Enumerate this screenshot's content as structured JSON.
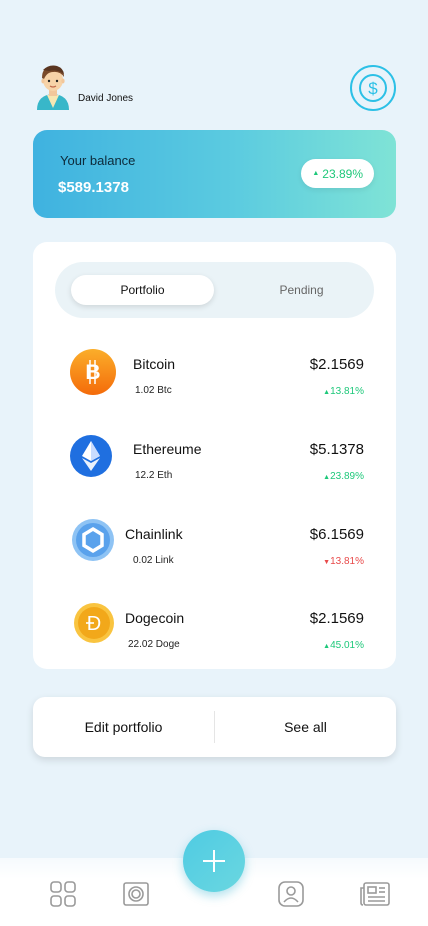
{
  "user": {
    "name": "David Jones",
    "avatar_icon": "boy-avatar-icon"
  },
  "header": {
    "coin_icon": "dollar-coin-icon",
    "accent": "#2cc0e6"
  },
  "balance": {
    "label": "Your balance",
    "value": "$589.1378",
    "change": "23.89%",
    "change_direction": "up"
  },
  "tabs": [
    {
      "label": "Portfolio",
      "active": true
    },
    {
      "label": "Pending",
      "active": false
    }
  ],
  "assets": [
    {
      "name": "Bitcoin",
      "amount": "1.02 Btc",
      "price": "$2.1569",
      "change": "13.81%",
      "direction": "up",
      "icon": "bitcoin-icon",
      "color": "#f7931a"
    },
    {
      "name": "Ethereume",
      "amount": "12.2 Eth",
      "price": "$5.1378",
      "change": "23.89%",
      "direction": "up",
      "icon": "ethereum-icon",
      "color": "#1f6fe0"
    },
    {
      "name": "Chainlink",
      "amount": "0.02 Link",
      "price": "$6.1569",
      "change": "13.81%",
      "direction": "down",
      "icon": "chainlink-icon",
      "color": "#7fb9f2"
    },
    {
      "name": "Dogecoin",
      "amount": "22.02 Doge",
      "price": "$2.1569",
      "change": "45.01%",
      "direction": "up",
      "icon": "dogecoin-icon",
      "color": "#f2b21f"
    }
  ],
  "actions": {
    "edit_label": "Edit portfolio",
    "see_all_label": "See all"
  },
  "nav": {
    "items": [
      "dashboard-icon",
      "wallet-icon",
      "profile-icon",
      "news-icon"
    ],
    "fab_icon": "plus-icon"
  },
  "colors": {
    "up": "#1ec87a",
    "down": "#e84a4a"
  }
}
